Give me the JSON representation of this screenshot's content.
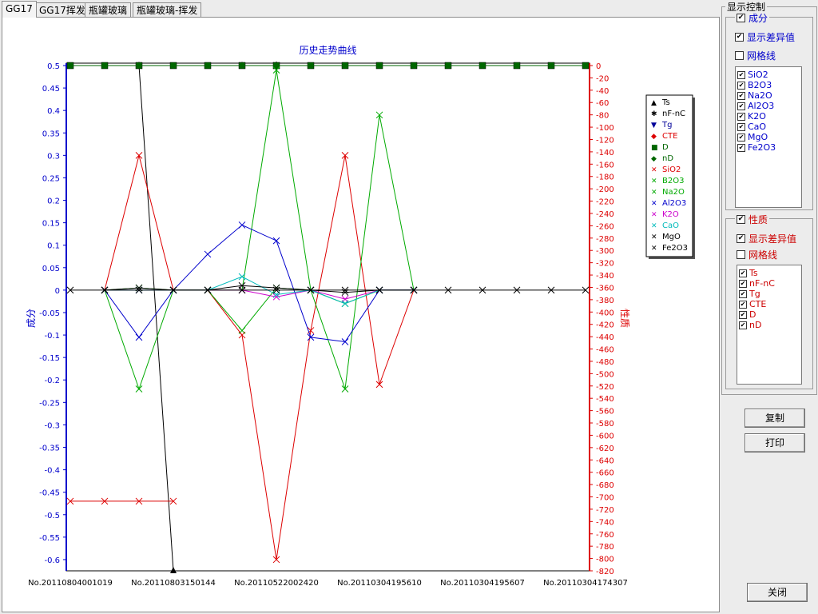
{
  "tabs": [
    {
      "label": "GG17",
      "active": true
    },
    {
      "label": "GG17挥发",
      "active": false
    },
    {
      "label": "瓶罐玻璃",
      "active": false
    },
    {
      "label": "瓶罐玻璃-挥发",
      "active": false
    }
  ],
  "panel": {
    "title": "显示控制",
    "composition": {
      "title": "成分",
      "checked": true,
      "show_diff_label": "显示差异值",
      "show_diff": true,
      "grid_label": "网格线",
      "grid": false,
      "items": [
        "SiO2",
        "B2O3",
        "Na2O",
        "Al2O3",
        "K2O",
        "CaO",
        "MgO",
        "Fe2O3"
      ]
    },
    "properties": {
      "title": "性质",
      "checked": true,
      "show_diff_label": "显示差异值",
      "show_diff": true,
      "grid_label": "网格线",
      "grid": false,
      "items": [
        "Ts",
        "nF-nC",
        "Tg",
        "CTE",
        "D",
        "nD"
      ]
    },
    "copy_label": "复制",
    "print_label": "打印",
    "close_label": "关闭"
  },
  "colors": {
    "composition_axis": "#0000cc",
    "property_axis": "#dd0000",
    "composition_text": "#0000cc",
    "property_text": "#cc0000"
  },
  "chart_data": {
    "type": "line",
    "title": "历史走势曲线",
    "ylabel_left": "成分",
    "ylabel_right": "性质",
    "ylim_left": [
      -0.625,
      0.5
    ],
    "ylim_right": [
      -820,
      0
    ],
    "yticks_left": [
      0.5,
      0.45,
      0.4,
      0.35,
      0.3,
      0.25,
      0.2,
      0.15,
      0.1,
      0.05,
      0,
      -0.05,
      -0.1,
      -0.15,
      -0.2,
      -0.25,
      -0.3,
      -0.35,
      -0.4,
      -0.45,
      -0.5,
      -0.55,
      -0.6
    ],
    "ytick_labels_left": [
      "0.5",
      "0.45",
      "0.4",
      "0.35",
      "0.3",
      "0.25",
      "0.2",
      "0.15",
      "0.1",
      "0.05",
      "0",
      "-0.05",
      "-0.1",
      "-0.15",
      "-0.2",
      "-0.25",
      "-0.3",
      "-0.35",
      "-0.4",
      "-0.45",
      "-0.5",
      "-0.55",
      "-0.6"
    ],
    "yticks_right": [
      0,
      -20,
      -40,
      -60,
      -80,
      -100,
      -120,
      -140,
      -160,
      -180,
      -200,
      -220,
      -240,
      -260,
      -280,
      -300,
      -320,
      -340,
      -360,
      -380,
      -400,
      -420,
      -440,
      -460,
      -480,
      -500,
      -520,
      -540,
      -560,
      -580,
      -600,
      -620,
      -640,
      -660,
      -680,
      -700,
      -720,
      -740,
      -760,
      -780,
      -800,
      -820
    ],
    "ytick_labels_right": [
      "0",
      "-20",
      "-40",
      "-60",
      "-80",
      "-100",
      "-120",
      "-140",
      "-160",
      "-180",
      "-200",
      "-220",
      "-240",
      "-260",
      "-280",
      "-300",
      "-320",
      "-340",
      "-360",
      "-380",
      "-400",
      "-420",
      "-440",
      "-460",
      "-480",
      "-500",
      "-520",
      "-540",
      "-560",
      "-580",
      "-600",
      "-620",
      "-640",
      "-660",
      "-680",
      "-700",
      "-720",
      "-740",
      "-760",
      "-780",
      "-800",
      "-820"
    ],
    "x_count": 16,
    "xtick_labels": [
      "No.20110804001019",
      "No.20110803150144",
      "No.20110522002420",
      "No.20110304195610",
      "No.20110304195607",
      "No.20110304174307"
    ],
    "xtick_index": [
      0,
      3,
      6,
      9,
      12,
      15
    ],
    "series": [
      {
        "name": "Ts",
        "axis": "right",
        "color": "#000000",
        "marker": "triangle",
        "values": [
          null,
          null,
          0,
          -820,
          null,
          0,
          null,
          null,
          null,
          null,
          null,
          null,
          null,
          null,
          null,
          null
        ]
      },
      {
        "name": "nF-nC",
        "axis": "right",
        "color": "#000000",
        "marker": "asterisk",
        "values": [
          null,
          null,
          null,
          null,
          null,
          null,
          0,
          null,
          null,
          null,
          null,
          null,
          null,
          null,
          null,
          null
        ]
      },
      {
        "name": "Tg",
        "axis": "right",
        "color": "#000099",
        "marker": "tri-down",
        "values": [
          0,
          0,
          0,
          0,
          0,
          0,
          0,
          0,
          0,
          0,
          0,
          0,
          0,
          0,
          0,
          0
        ]
      },
      {
        "name": "CTE",
        "axis": "right",
        "color": "#dd0000",
        "marker": "diamond",
        "values": [
          0,
          0,
          0,
          0,
          0,
          0,
          0,
          0,
          0,
          0,
          0,
          0,
          0,
          0,
          0,
          0
        ]
      },
      {
        "name": "D",
        "axis": "right",
        "color": "#006600",
        "marker": "square",
        "values": [
          0,
          0,
          0,
          0,
          0,
          0,
          0,
          0,
          0,
          0,
          0,
          0,
          0,
          0,
          0,
          0
        ]
      },
      {
        "name": "nD",
        "axis": "right",
        "color": "#006600",
        "marker": "diamond",
        "values": [
          0,
          0,
          0,
          0,
          0,
          0,
          0,
          0,
          0,
          0,
          0,
          0,
          0,
          0,
          0,
          0
        ]
      },
      {
        "name": "SiO2",
        "axis": "left",
        "color": "#dd0000",
        "marker": "x",
        "values": [
          -0.47,
          -0.47,
          -0.47,
          -0.47,
          null,
          null,
          null,
          null,
          null,
          null,
          null,
          null,
          null,
          null,
          null,
          null
        ]
      },
      {
        "name": "SiO2-diff",
        "axis": "left",
        "color": "#dd0000",
        "marker": "x",
        "values": [
          null,
          0,
          0.3,
          0,
          0,
          -0.1,
          -0.6,
          -0.09,
          0.3,
          -0.21,
          0,
          null,
          null,
          null,
          null,
          null
        ]
      },
      {
        "name": "B2O3",
        "axis": "left",
        "color": "#00aa00",
        "marker": "x",
        "values": [
          null,
          0,
          -0.22,
          0,
          0,
          0,
          0.49,
          0,
          -0.22,
          0.39,
          0,
          null,
          null,
          null,
          null,
          null
        ]
      },
      {
        "name": "Na2O",
        "axis": "left",
        "color": "#00aa00",
        "marker": "x",
        "values": [
          null,
          0,
          0.005,
          0,
          0,
          -0.09,
          0.005,
          0,
          -0.03,
          0,
          0,
          null,
          null,
          null,
          null,
          null
        ]
      },
      {
        "name": "Al2O3",
        "axis": "left",
        "color": "#0000cc",
        "marker": "x",
        "values": [
          null,
          0,
          -0.105,
          0,
          0.08,
          0.145,
          0.11,
          -0.105,
          -0.115,
          0,
          0,
          null,
          null,
          null,
          null,
          null
        ]
      },
      {
        "name": "K2O",
        "axis": "left",
        "color": "#cc00cc",
        "marker": "x",
        "values": [
          null,
          0,
          0,
          0,
          0,
          0,
          -0.015,
          0,
          -0.02,
          0,
          0,
          null,
          null,
          null,
          null,
          null
        ]
      },
      {
        "name": "CaO",
        "axis": "left",
        "color": "#00bbbb",
        "marker": "x",
        "values": [
          null,
          0,
          0,
          0,
          0,
          0.03,
          -0.01,
          0,
          -0.03,
          0,
          0,
          null,
          null,
          null,
          null,
          null
        ]
      },
      {
        "name": "MgO",
        "axis": "left",
        "color": "#000000",
        "marker": "x",
        "values": [
          0,
          0,
          0,
          0,
          0,
          0,
          0,
          0,
          0,
          0,
          0,
          0,
          0,
          0,
          0,
          0
        ]
      },
      {
        "name": "Fe2O3",
        "axis": "left",
        "color": "#000000",
        "marker": "x",
        "values": [
          null,
          0,
          0.005,
          0,
          0,
          0.01,
          0.005,
          0,
          -0.005,
          0,
          0,
          null,
          null,
          null,
          null,
          null
        ]
      }
    ],
    "legend": [
      {
        "name": "Ts",
        "color": "#000000",
        "marker": "▲"
      },
      {
        "name": "nF-nC",
        "color": "#000000",
        "marker": "✱"
      },
      {
        "name": "Tg",
        "color": "#000099",
        "marker": "▼"
      },
      {
        "name": "CTE",
        "color": "#dd0000",
        "marker": "◆"
      },
      {
        "name": "D",
        "color": "#006600",
        "marker": "■"
      },
      {
        "name": "nD",
        "color": "#006600",
        "marker": "◆"
      },
      {
        "name": "SiO2",
        "color": "#dd0000",
        "marker": "✕"
      },
      {
        "name": "B2O3",
        "color": "#00aa00",
        "marker": "✕"
      },
      {
        "name": "Na2O",
        "color": "#00aa00",
        "marker": "✕"
      },
      {
        "name": "Al2O3",
        "color": "#0000cc",
        "marker": "✕"
      },
      {
        "name": "K2O",
        "color": "#cc00cc",
        "marker": "✕"
      },
      {
        "name": "CaO",
        "color": "#00bbbb",
        "marker": "✕"
      },
      {
        "name": "MgO",
        "color": "#000000",
        "marker": "✕"
      },
      {
        "name": "Fe2O3",
        "color": "#000000",
        "marker": "✕"
      }
    ],
    "legend_position": "right",
    "grid": false
  }
}
